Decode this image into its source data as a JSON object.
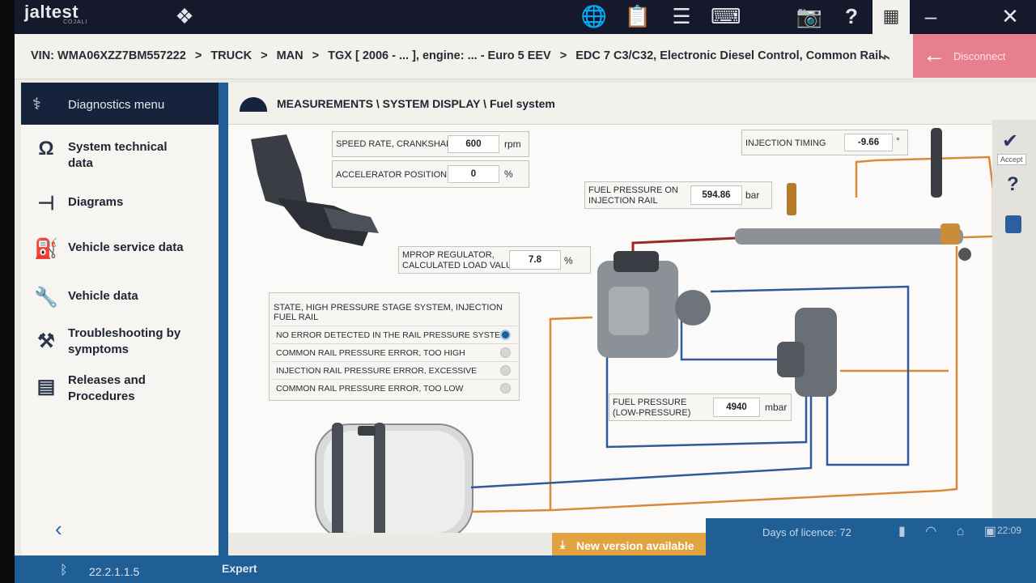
{
  "app": {
    "logo": "jaltest",
    "logo_sub": "COJALI"
  },
  "toolbar": {
    "icons": [
      "apps-icon",
      "globe-icon",
      "report-icon",
      "list-icon",
      "keyboard-icon",
      "camera-icon",
      "help-icon",
      "grid-icon",
      "minimize-icon",
      "close-icon"
    ],
    "minimize_glyph": "–",
    "close_glyph": "✕"
  },
  "breadcrumb": {
    "vin": "VIN: WMA06XZZ7BM557222",
    "parts": [
      "TRUCK",
      "MAN",
      "TGX [ 2006 - ... ], engine: ... - Euro 5 EEV",
      "EDC 7 C3/C32, Electronic Diesel Control, Common Rail"
    ],
    "sep": ">"
  },
  "disconnect": {
    "label": "Disconnect"
  },
  "sidebar": {
    "header": "Diagnostics menu",
    "items": [
      {
        "label": "System technical data",
        "icon": "omega-icon"
      },
      {
        "label": "Diagrams",
        "icon": "diagram-icon"
      },
      {
        "label": "Vehicle service data",
        "icon": "oil-can-icon"
      },
      {
        "label": "Vehicle data",
        "icon": "wrench-icon"
      },
      {
        "label": "Troubleshooting by symptoms",
        "icon": "troubleshooting-icon"
      },
      {
        "label": "Releases and Procedures",
        "icon": "procedures-icon"
      }
    ]
  },
  "main": {
    "title": "MEASUREMENTS \\ SYSTEM DISPLAY \\ Fuel system"
  },
  "right_panel": {
    "accept_tooltip": "Accept"
  },
  "measurements": {
    "speed": {
      "label": "SPEED RATE, CRANKSHAFT",
      "value": "600",
      "unit": "rpm"
    },
    "accel": {
      "label": "ACCELERATOR POSITION",
      "value": "0",
      "unit": "%"
    },
    "mprop": {
      "label1": "MPROP REGULATOR,",
      "label2": "CALCULATED LOAD VALUE",
      "value": "7.8",
      "unit": "%"
    },
    "fuel_rail": {
      "label1": "FUEL PRESSURE ON",
      "label2": "INJECTION RAIL",
      "value": "594.86",
      "unit": "bar"
    },
    "timing": {
      "label": "INJECTION TIMING",
      "value": "-9.66",
      "unit": "°"
    },
    "low_pressure": {
      "label1": "FUEL PRESSURE",
      "label2": "(LOW-PRESSURE)",
      "value": "4940",
      "unit": "mbar"
    }
  },
  "state": {
    "title": "STATE, HIGH PRESSURE STAGE SYSTEM, INJECTION FUEL RAIL",
    "options": [
      {
        "label": "NO ERROR DETECTED IN THE RAIL PRESSURE SYSTEM",
        "active": true
      },
      {
        "label": "COMMON RAIL PRESSURE ERROR, TOO HIGH",
        "active": false
      },
      {
        "label": "INJECTION RAIL PRESSURE ERROR, EXCESSIVE",
        "active": false
      },
      {
        "label": "COMMON RAIL PRESSURE ERROR, TOO LOW",
        "active": false
      }
    ]
  },
  "status": {
    "version": "22.2.1.1.5",
    "mode": "Expert",
    "new_version": "New version available",
    "licence": "Days of licence: 72",
    "clock": "22:09"
  },
  "colors": {
    "navy": "#16233d",
    "blue": "#1f5f96",
    "orange_line": "#d88a3a",
    "blue_line": "#2f5a9c",
    "red_line": "#9a2a2a",
    "disconnect": "#e87f8e",
    "banner": "#e0a340"
  }
}
